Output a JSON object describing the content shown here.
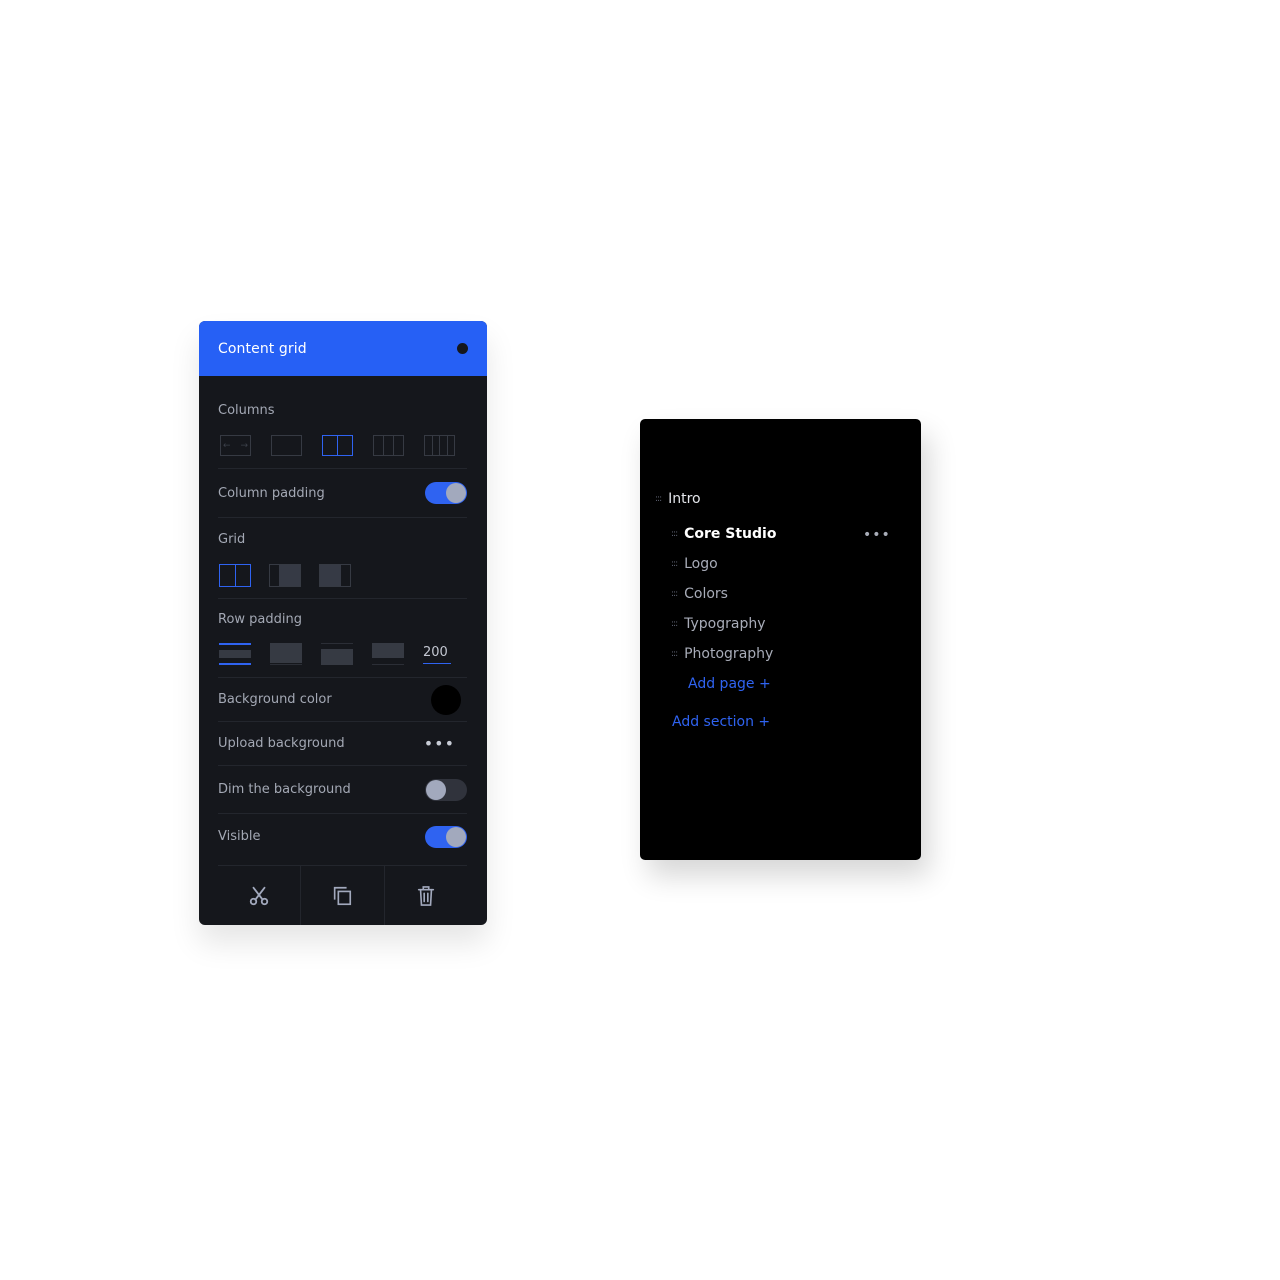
{
  "content_grid_panel": {
    "title": "Content grid",
    "header_dot_icon": "circle-icon",
    "columns": {
      "label": "Columns",
      "options": [
        {
          "name": "full-width",
          "icon": "arrows-horizontal-icon",
          "selected": false
        },
        {
          "name": "1-column",
          "selected": false
        },
        {
          "name": "2-columns",
          "selected": true
        },
        {
          "name": "3-columns",
          "selected": false
        },
        {
          "name": "4-columns",
          "selected": false
        }
      ]
    },
    "column_padding": {
      "label": "Column padding",
      "enabled": true
    },
    "grid": {
      "label": "Grid",
      "options": [
        {
          "name": "equal-split",
          "selected": true
        },
        {
          "name": "narrow-left",
          "selected": false
        },
        {
          "name": "narrow-right",
          "selected": false
        }
      ]
    },
    "row_padding": {
      "label": "Row padding",
      "options": [
        {
          "name": "small",
          "selected": true
        },
        {
          "name": "medium",
          "selected": false
        },
        {
          "name": "large",
          "selected": false
        },
        {
          "name": "xlarge",
          "selected": false
        }
      ],
      "custom_value": "200"
    },
    "background_color": {
      "label": "Background color",
      "value": "#000000"
    },
    "upload_background": {
      "label": "Upload background",
      "more_icon": "more-horizontal-icon",
      "more_text": "•••"
    },
    "dim_background": {
      "label": "Dim the background",
      "enabled": false
    },
    "visible": {
      "label": "Visible",
      "enabled": true
    },
    "footer_actions": [
      {
        "name": "cut",
        "icon": "scissors-icon"
      },
      {
        "name": "duplicate",
        "icon": "copy-icon"
      },
      {
        "name": "delete",
        "icon": "trash-icon"
      }
    ]
  },
  "page_tree": {
    "handle_glyph": ":::",
    "section": {
      "label": "Intro"
    },
    "pages": [
      {
        "label": "Core Studio",
        "active": true
      },
      {
        "label": "Logo",
        "active": false
      },
      {
        "label": "Colors",
        "active": false
      },
      {
        "label": "Typography",
        "active": false
      },
      {
        "label": "Photography",
        "active": false
      }
    ],
    "more_text": "•••",
    "add_page": "Add page +",
    "add_section": "Add section +"
  },
  "colors": {
    "accent": "#2660f5",
    "panel_bg": "#15171c",
    "tree_bg": "#000000"
  }
}
